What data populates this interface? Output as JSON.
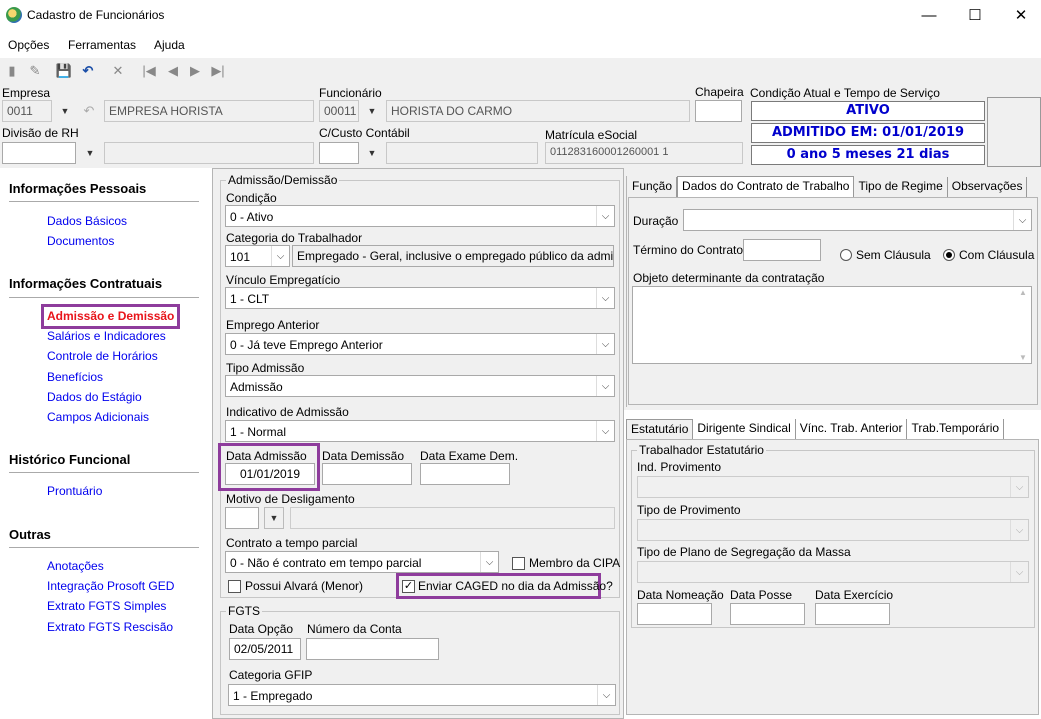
{
  "window": {
    "title": "Cadastro de Funcionários"
  },
  "menu": [
    "Opções",
    "Ferramentas",
    "Ajuda"
  ],
  "header": {
    "empresa_label": "Empresa",
    "empresa_code": "0011",
    "empresa_name": "EMPRESA HORISTA",
    "funcionario_label": "Funcionário",
    "funcionario_code": "00011",
    "funcionario_name": "HORISTA DO CARMO",
    "chapeira_label": "Chapeira",
    "chapeira_value": "",
    "divisao_label": "Divisão de RH",
    "divisao_value": "",
    "custo_label": "C/Custo Contábil",
    "custo_value": "",
    "matricula_label": "Matrícula eSocial",
    "matricula_value": "011283160001260001 1",
    "condicao_label": "Condição Atual e Tempo de Serviço",
    "status": "ATIVO",
    "admitido": "ADMITIDO EM: 01/01/2019",
    "tempo": "0 ano 5 meses 21 dias"
  },
  "sidebar": {
    "sections": [
      {
        "title": "Informações Pessoais",
        "items": [
          "Dados Básicos",
          "Documentos"
        ]
      },
      {
        "title": "Informações Contratuais",
        "items": [
          "Admissão e Demissão",
          "Salários e Indicadores",
          "Controle de Horários",
          "Benefícios",
          "Dados do Estágio",
          "Campos Adicionais"
        ]
      },
      {
        "title": "Histórico Funcional",
        "items": [
          "Prontuário"
        ]
      },
      {
        "title": "Outras",
        "items": [
          "Anotações",
          "Integração Prosoft GED",
          "Extrato FGTS Simples",
          "Extrato FGTS Rescisão"
        ]
      }
    ]
  },
  "admissao": {
    "group_title": "Admissão/Demissão",
    "condicao_label": "Condição",
    "condicao_value": "0 - Ativo",
    "categoria_label": "Categoria do Trabalhador",
    "categoria_code": "101",
    "categoria_desc": "Empregado - Geral, inclusive o empregado público da administ",
    "vinculo_label": "Vínculo Empregatício",
    "vinculo_value": "1 - CLT",
    "emprego_label": "Emprego Anterior",
    "emprego_value": "0 - Já teve Emprego Anterior",
    "tipo_label": "Tipo Admissão",
    "tipo_value": "Admissão",
    "indicativo_label": "Indicativo de Admissão",
    "indicativo_value": "1 - Normal",
    "data_adm_label": "Data Admissão",
    "data_adm_value": "01/01/2019",
    "data_dem_label": "Data Demissão",
    "data_dem_value": "",
    "data_exame_label": "Data Exame Dem.",
    "data_exame_value": "",
    "motivo_label": "Motivo de Desligamento",
    "contrato_label": "Contrato a tempo parcial",
    "contrato_value": "0 - Não é contrato em tempo parcial",
    "membro_cipa": "Membro da CIPA",
    "alvara": "Possui Alvará (Menor)",
    "caged": "Enviar CAGED no dia da Admissão?"
  },
  "fgts": {
    "group_title": "FGTS",
    "data_opcao_label": "Data Opção",
    "data_opcao_value": "02/05/2011",
    "conta_label": "Número da Conta",
    "conta_value": "",
    "categoria_label": "Categoria GFIP",
    "categoria_value": "1 - Empregado"
  },
  "contrato_tabs": [
    "Função",
    "Dados do Contrato de Trabalho",
    "Tipo de Regime",
    "Observações"
  ],
  "contrato": {
    "duracao_label": "Duração",
    "termino_label": "Término do Contrato",
    "sem_clausula": "Sem Cláusula",
    "com_clausula": "Com Cláusula",
    "objeto_label": "Objeto determinante da contratação"
  },
  "estat_tabs": [
    "Estatutário",
    "Dirigente Sindical",
    "Vínc. Trab. Anterior",
    "Trab.Temporário"
  ],
  "estatutario": {
    "group_title": "Trabalhador Estatutário",
    "ind_label": "Ind. Provimento",
    "tipo_label": "Tipo de Provimento",
    "plano_label": "Tipo de Plano de Segregação da Massa",
    "nomeacao_label": "Data Nomeação",
    "posse_label": "Data Posse",
    "exercicio_label": "Data Exercício"
  },
  "colors": {
    "link": "#0000ee",
    "active_link": "#e8141a",
    "highlight": "#8e3c9c",
    "status_text": "#0000cc"
  }
}
